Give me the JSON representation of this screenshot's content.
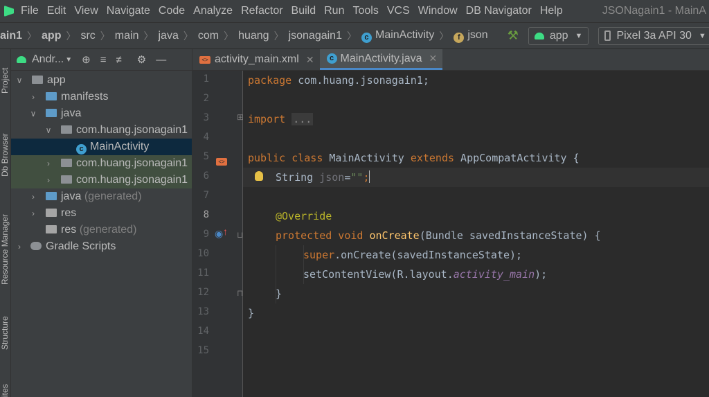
{
  "menu": {
    "items": [
      "File",
      "Edit",
      "View",
      "Navigate",
      "Code",
      "Analyze",
      "Refactor",
      "Build",
      "Run",
      "Tools",
      "VCS",
      "Window",
      "DB Navigator",
      "Help"
    ],
    "window_title": "JSONagain1 - MainA"
  },
  "breadcrumb": {
    "items": [
      "ain1",
      "app",
      "src",
      "main",
      "java",
      "com",
      "huang",
      "jsonagain1"
    ],
    "class_name": "MainActivity",
    "field_name": "json"
  },
  "toolbar": {
    "run_config": "app",
    "device": "Pixel 3a API 30"
  },
  "side_tabs": [
    "Project",
    "Db Browser",
    "Resource Manager",
    "Structure",
    "ites"
  ],
  "project_panel": {
    "view_selector": "Andr...",
    "tree": [
      {
        "label": "app",
        "suffix": ""
      },
      {
        "label": "manifests",
        "suffix": ""
      },
      {
        "label": "java",
        "suffix": ""
      },
      {
        "label": "com.huang.jsonagain1",
        "suffix": ""
      },
      {
        "label": "MainActivity",
        "suffix": ""
      },
      {
        "label": "com.huang.jsonagain1",
        "suffix": ""
      },
      {
        "label": "com.huang.jsonagain1",
        "suffix": ""
      },
      {
        "label": "java",
        "suffix": "(generated)"
      },
      {
        "label": "res",
        "suffix": ""
      },
      {
        "label": "res",
        "suffix": "(generated)"
      },
      {
        "label": "Gradle Scripts",
        "suffix": ""
      }
    ]
  },
  "editor": {
    "tabs": [
      "activity_main.xml",
      "MainActivity.java"
    ],
    "active_tab": "MainActivity.java",
    "line_numbers": [
      "1",
      "2",
      "3",
      "4",
      "5",
      "6",
      "7",
      "8",
      "9",
      "10",
      "11",
      "12",
      "13",
      "14",
      "15"
    ],
    "current_line": "8",
    "code": {
      "l1_kw": "package",
      "l1_rest": " com.huang.jsonagain1;",
      "l3_kw": "import",
      "l3_fold": "...",
      "l7_kw1": "public class",
      "l7_name": " MainActivity ",
      "l7_kw2": "extends",
      "l7_rest": " AppCompatActivity {",
      "l8_type": "String ",
      "l8_var": "json",
      "l8_eq": "=",
      "l8_str": "\"\"",
      "l8_semi": ";",
      "l10_ann": "@Override",
      "l11_kw": "protected void",
      "l11_fn": " onCreate",
      "l11_rest": "(Bundle savedInstanceState) {",
      "l12_kw": "super",
      "l12_rest": ".onCreate(savedInstanceState);",
      "l13_a": "setContentView(R.layout.",
      "l13_it": "activity_main",
      "l13_b": ");",
      "l14": "}",
      "l15": "}"
    }
  }
}
